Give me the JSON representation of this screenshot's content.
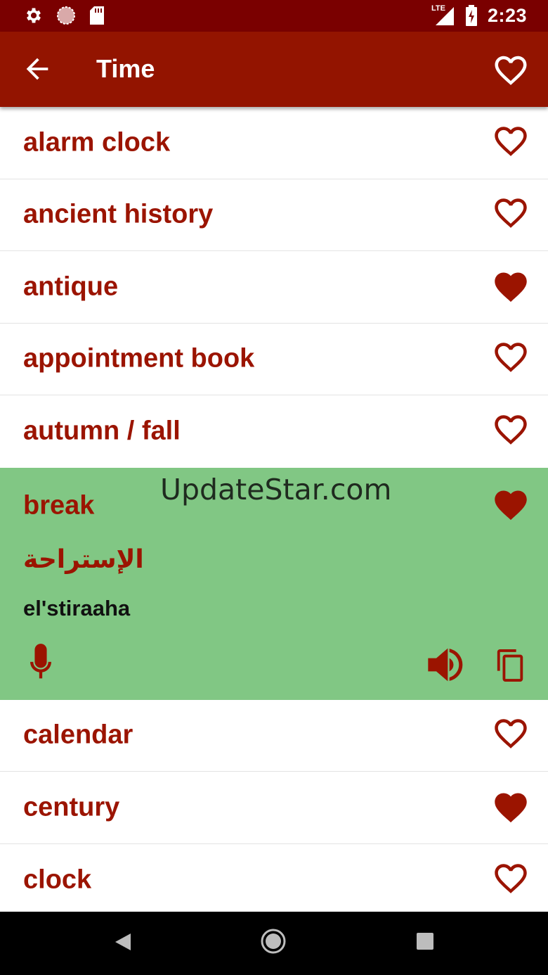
{
  "status_bar": {
    "time": "2:23",
    "network": "LTE",
    "left_icons": [
      "settings-icon",
      "sync-icon",
      "sd-card-icon"
    ],
    "right_icons": [
      "signal-icon",
      "battery-charging-icon"
    ]
  },
  "app_bar": {
    "title": "Time",
    "back_icon": "arrow-left-icon",
    "favorite_icon": "heart-outline-icon"
  },
  "colors": {
    "status_bar": "#7a0000",
    "app_bar": "#931400",
    "accent_text": "#9b1400",
    "expanded_row": "#81c784"
  },
  "words": [
    {
      "word": "alarm clock",
      "favorite": false
    },
    {
      "word": "ancient history",
      "favorite": false
    },
    {
      "word": "antique",
      "favorite": true
    },
    {
      "word": "appointment book",
      "favorite": false
    },
    {
      "word": "autumn / fall",
      "favorite": false
    },
    {
      "word": "break",
      "favorite": true,
      "expanded": true,
      "translation": "الإستراحة",
      "transliteration": "el'stiraaha"
    },
    {
      "word": "calendar",
      "favorite": false
    },
    {
      "word": "century",
      "favorite": true
    },
    {
      "word": "clock",
      "favorite": false
    }
  ],
  "watermark": "UpdateStar.com"
}
